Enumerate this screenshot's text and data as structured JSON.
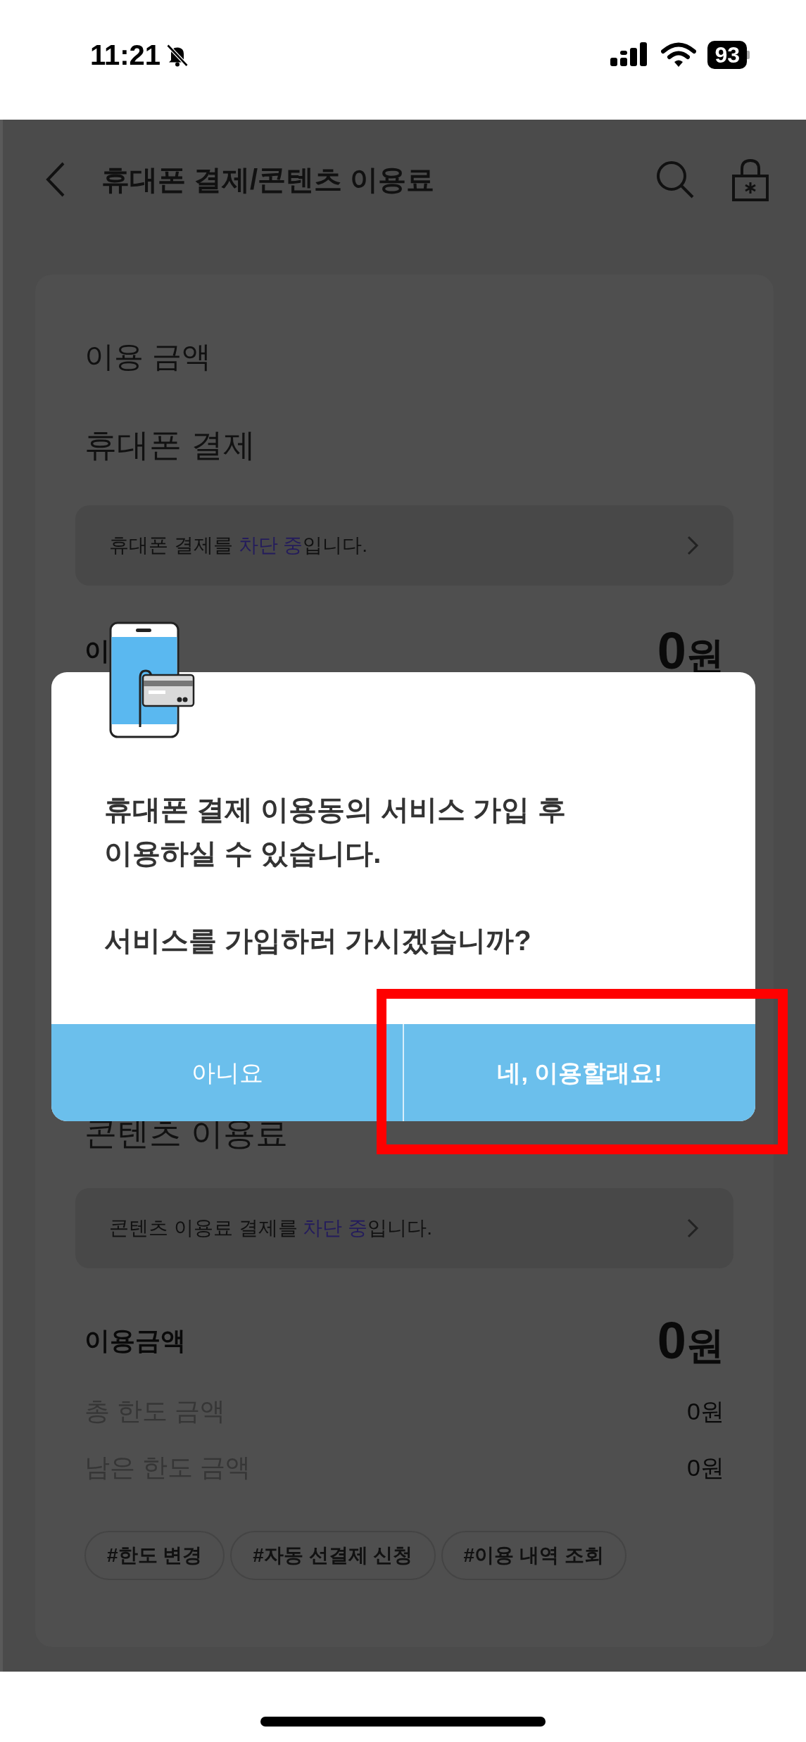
{
  "status_bar": {
    "time": "11:21",
    "battery": "93"
  },
  "header": {
    "title": "휴대폰 결제/콘텐츠 이용료"
  },
  "card": {
    "heading": "이용 금액",
    "sections": [
      {
        "title": "휴대폰 결제",
        "notice": {
          "before": "휴대폰 결제를 ",
          "highlight": "차단 중",
          "after": "입니다."
        },
        "amount_label": "이",
        "amount_number": "0",
        "amount_unit": "원"
      },
      {
        "title": "콘텐츠 이용료",
        "notice": {
          "before": "콘텐츠 이용료 결제를 ",
          "highlight": "차단 중",
          "after": "입니다."
        },
        "amount_label": "이용금액",
        "amount_number": "0",
        "amount_unit": "원",
        "limits": [
          {
            "label": "총 한도 금액",
            "value": "0원"
          },
          {
            "label": "남은 한도 금액",
            "value": "0원"
          }
        ],
        "tags": [
          "#한도 변경",
          "#자동 선결제 신청",
          "#이용 내역 조회"
        ]
      }
    ]
  },
  "dialog": {
    "paragraphs": [
      "휴대폰 결제 이용동의 서비스 가입 후\n이용하실 수 있습니다.",
      "서비스를 가입하러 가시겠습니까?"
    ],
    "buttons": [
      {
        "label": "아니요",
        "kind": "cancel"
      },
      {
        "label": "네, 이용할래요!",
        "kind": "confirm"
      }
    ]
  }
}
